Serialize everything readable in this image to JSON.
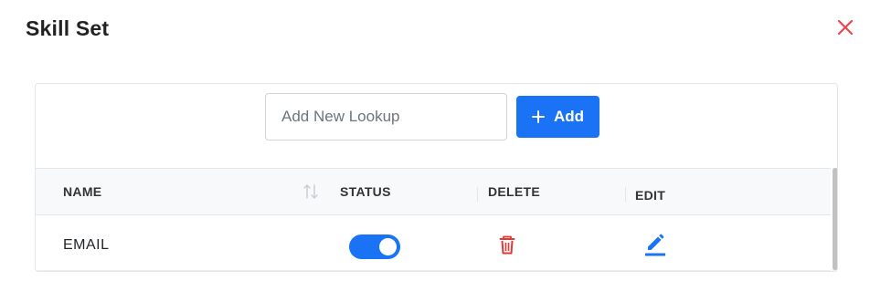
{
  "modal": {
    "title": "Skill Set",
    "close_icon": "close-icon"
  },
  "toolbar": {
    "input_value": "",
    "input_placeholder": "Add New Lookup",
    "add_label": "Add",
    "add_icon": "plus-icon"
  },
  "table": {
    "columns": [
      {
        "label": "NAME",
        "sortable": true
      },
      {
        "label": "STATUS"
      },
      {
        "label": "DELETE"
      },
      {
        "label": "EDIT"
      }
    ],
    "rows": [
      {
        "name": "EMAIL",
        "status_enabled": true,
        "delete_icon": "trash-icon",
        "edit_icon": "pencil-icon"
      }
    ]
  },
  "colors": {
    "primary": "#1a73f5",
    "danger": "#e53935",
    "close": "#e8494f"
  }
}
